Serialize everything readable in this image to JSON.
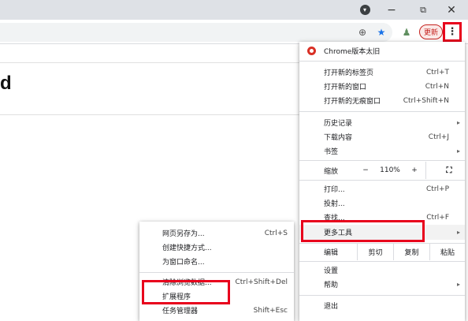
{
  "window": {
    "minimize": "−",
    "restore": "⧉",
    "close": "✕",
    "profile_glyph": "▾"
  },
  "toolbar": {
    "zoom_glyph": "⊕",
    "star_glyph": "★",
    "extension_glyph": "♟",
    "update_label": "更新",
    "menu_glyph": "⋮"
  },
  "page": {
    "heading": "d"
  },
  "main_menu": {
    "chrome_outdated": "Chrome版本太旧",
    "new_tab": "打开新的标签页",
    "new_tab_sc": "Ctrl+T",
    "new_window": "打开新的窗口",
    "new_window_sc": "Ctrl+N",
    "incognito": "打开新的无痕窗口",
    "incognito_sc": "Ctrl+Shift+N",
    "history": "历史记录",
    "downloads": "下载内容",
    "downloads_sc": "Ctrl+J",
    "bookmarks": "书签",
    "zoom_label": "缩放",
    "zoom_minus": "−",
    "zoom_value": "110%",
    "zoom_plus": "+",
    "fullscreen": "⛶",
    "print": "打印...",
    "print_sc": "Ctrl+P",
    "cast": "投射...",
    "find": "查找...",
    "find_sc": "Ctrl+F",
    "more_tools": "更多工具",
    "edit_label": "编辑",
    "cut": "剪切",
    "copy": "复制",
    "paste": "粘贴",
    "settings": "设置",
    "help": "帮助",
    "exit": "退出",
    "arrow": "▸"
  },
  "sub_menu": {
    "save_page": "网页另存为...",
    "save_page_sc": "Ctrl+S",
    "create_shortcut": "创建快捷方式...",
    "name_window": "为窗口命名...",
    "clear_data": "清除浏览数据...",
    "clear_data_sc": "Ctrl+Shift+Del",
    "extensions": "扩展程序",
    "task_manager": "任务管理器",
    "task_manager_sc": "Shift+Esc"
  },
  "colors": {
    "highlight": "#e8001c",
    "titlebar": "#dee1e6",
    "star": "#1a73e8"
  }
}
